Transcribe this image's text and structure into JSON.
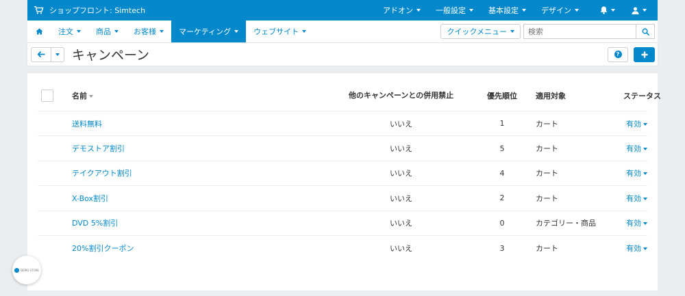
{
  "topbar": {
    "store_label": "ショップフロント: Simtech",
    "menus": [
      "アドオン",
      "一般設定",
      "基本設定",
      "デザイン"
    ]
  },
  "nav": {
    "items": [
      "注文",
      "商品",
      "お客様",
      "マーケティング",
      "ウェブサイト"
    ],
    "active": "マーケティング",
    "quick_menu": "クイックメニュー",
    "search_placeholder": "検索"
  },
  "page": {
    "title": "キャンペーン"
  },
  "table": {
    "headers": {
      "name": "名前",
      "exclusive": "他のキャンペーンとの併用禁止",
      "priority": "優先順位",
      "target": "適用対象",
      "status": "ステータス"
    },
    "rows": [
      {
        "name": "送料無料",
        "exclusive": "いいえ",
        "priority": "1",
        "target": "カート",
        "status": "有効"
      },
      {
        "name": "デモストア割引",
        "exclusive": "いいえ",
        "priority": "5",
        "target": "カート",
        "status": "有効"
      },
      {
        "name": "テイクアウト割引",
        "exclusive": "いいえ",
        "priority": "4",
        "target": "カート",
        "status": "有効"
      },
      {
        "name": "X-Box割引",
        "exclusive": "いいえ",
        "priority": "2",
        "target": "カート",
        "status": "有効"
      },
      {
        "name": "DVD 5%割引",
        "exclusive": "いいえ",
        "priority": "0",
        "target": "カテゴリー・商品",
        "status": "有効"
      },
      {
        "name": "20%割引クーポン",
        "exclusive": "いいえ",
        "priority": "3",
        "target": "カート",
        "status": "有効"
      }
    ]
  },
  "badge": {
    "text": "DEMO STORE"
  },
  "colors": {
    "primary": "#0388cc",
    "background": "#ebeef0"
  }
}
